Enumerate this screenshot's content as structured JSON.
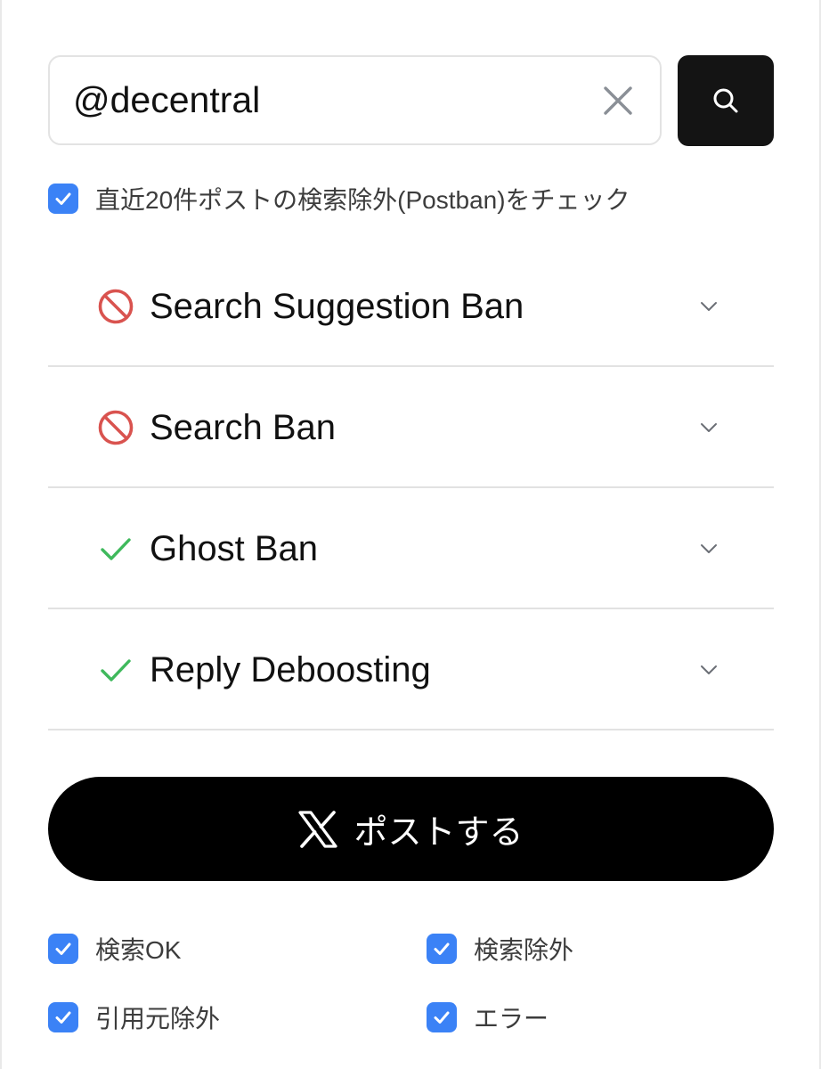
{
  "search": {
    "value": "@decentral"
  },
  "postban_check": {
    "checked": true,
    "label": "直近20件ポストの検索除外(Postban)をチェック"
  },
  "checks": [
    {
      "status": "banned",
      "icon": "prohibited-icon",
      "title": "Search Suggestion Ban"
    },
    {
      "status": "banned",
      "icon": "prohibited-icon",
      "title": "Search Ban"
    },
    {
      "status": "ok",
      "icon": "checkmark-icon",
      "title": "Ghost Ban"
    },
    {
      "status": "ok",
      "icon": "checkmark-icon",
      "title": "Reply Deboosting"
    }
  ],
  "post_button": {
    "label": "ポストする",
    "icon": "x-logo-icon"
  },
  "filters": [
    {
      "label": "検索OK",
      "checked": true
    },
    {
      "label": "検索除外",
      "checked": true
    },
    {
      "label": "引用元除外",
      "checked": true
    },
    {
      "label": "エラー",
      "checked": true
    }
  ],
  "colors": {
    "checkbox": "#3b82f6",
    "banned": "#d9534f",
    "ok": "#3fb95c",
    "post_button": "#000000",
    "search_button": "#141414"
  }
}
